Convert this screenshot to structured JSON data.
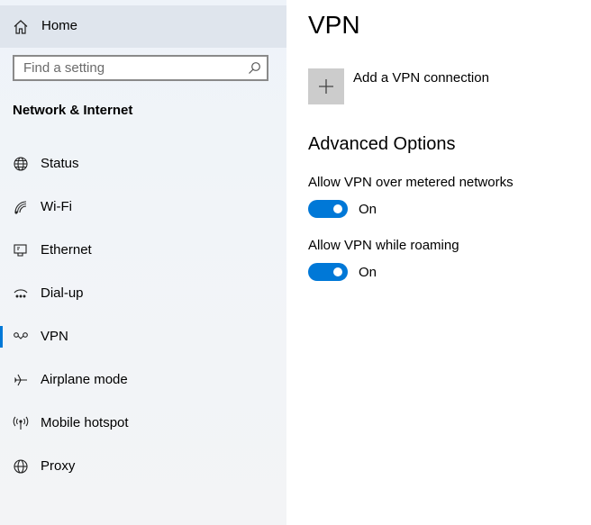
{
  "sidebar": {
    "home_label": "Home",
    "search_placeholder": "Find a setting",
    "section_title": "Network & Internet",
    "items": [
      {
        "label": "Status",
        "icon": "globe-status-icon"
      },
      {
        "label": "Wi-Fi",
        "icon": "wifi-icon"
      },
      {
        "label": "Ethernet",
        "icon": "ethernet-icon"
      },
      {
        "label": "Dial-up",
        "icon": "dial-up-icon"
      },
      {
        "label": "VPN",
        "icon": "vpn-icon",
        "active": true
      },
      {
        "label": "Airplane mode",
        "icon": "airplane-icon"
      },
      {
        "label": "Mobile hotspot",
        "icon": "hotspot-icon"
      },
      {
        "label": "Proxy",
        "icon": "globe-icon"
      }
    ]
  },
  "main": {
    "title": "VPN",
    "add_vpn_label": "Add a VPN connection",
    "advanced_title": "Advanced Options",
    "settings": [
      {
        "label": "Allow VPN over metered networks",
        "state": "On"
      },
      {
        "label": "Allow VPN while roaming",
        "state": "On"
      }
    ]
  },
  "colors": {
    "accent": "#0078d7",
    "sidebar_bg": "#f1f4f8",
    "home_highlight": "#dfe5ed",
    "add_tile": "#cccccc"
  }
}
